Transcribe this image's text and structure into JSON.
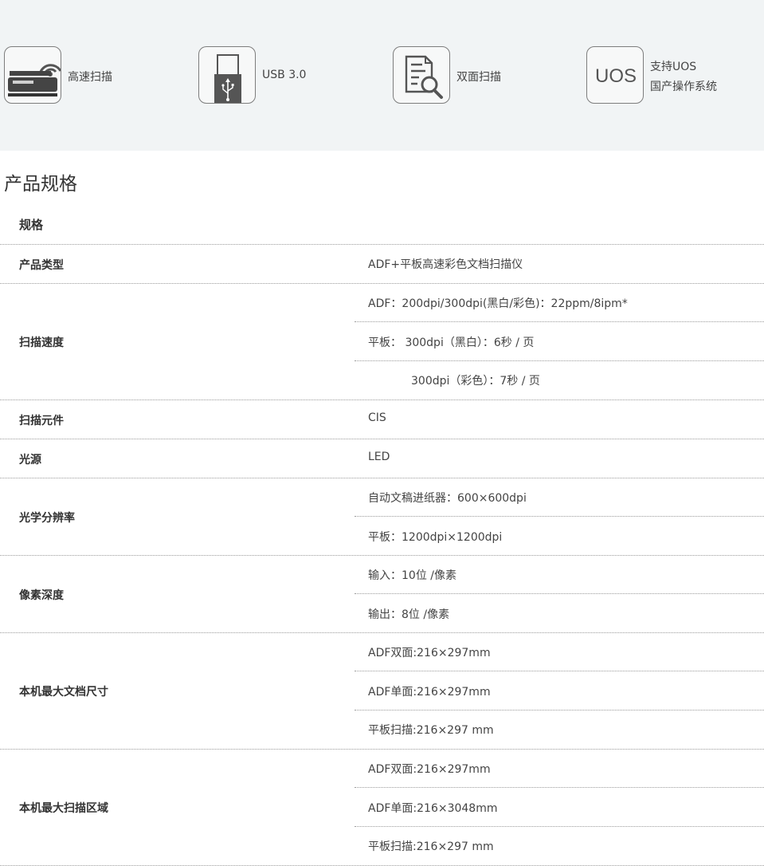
{
  "features": [
    {
      "icon": "scanner-icon",
      "label": "高速扫描"
    },
    {
      "icon": "usb-icon",
      "label": "USB 3.0"
    },
    {
      "icon": "duplex-scan-icon",
      "label": "双面扫描"
    },
    {
      "icon": "uos-icon",
      "icon_text": "UOS",
      "lines": [
        "支持UOS",
        "国产操作系统"
      ]
    }
  ],
  "section_title": "产品规格",
  "spec_header": "规格",
  "specs": [
    {
      "key": "产品类型",
      "values": [
        "ADF+平板高速彩色文档扫描仪"
      ]
    },
    {
      "key": "扫描速度",
      "values": [
        "ADF：200dpi/300dpi(黑白/彩色)：22ppm/8ipm*",
        "平板： 300dpi（黑白）：6秒 / 页",
        "300dpi（彩色）：7秒 / 页"
      ]
    },
    {
      "key": "扫描元件",
      "values": [
        "CIS"
      ]
    },
    {
      "key": "光源",
      "values": [
        "LED"
      ]
    },
    {
      "key": "光学分辨率",
      "values": [
        "自动文稿进纸器：600×600dpi",
        "平板：1200dpi×1200dpi"
      ]
    },
    {
      "key": "像素深度",
      "values": [
        "输入：10位 /像素",
        "输出：8位 /像素"
      ]
    },
    {
      "key": "本机最大文档尺寸",
      "values": [
        "ADF双面:216×297mm",
        "ADF单面:216×297mm",
        "平板扫描:216×297 mm"
      ]
    },
    {
      "key": "本机最大扫描区域",
      "values": [
        "ADF双面:216×297mm",
        "ADF单面:216×3048mm",
        "平板扫描:216×297 mm"
      ]
    }
  ]
}
